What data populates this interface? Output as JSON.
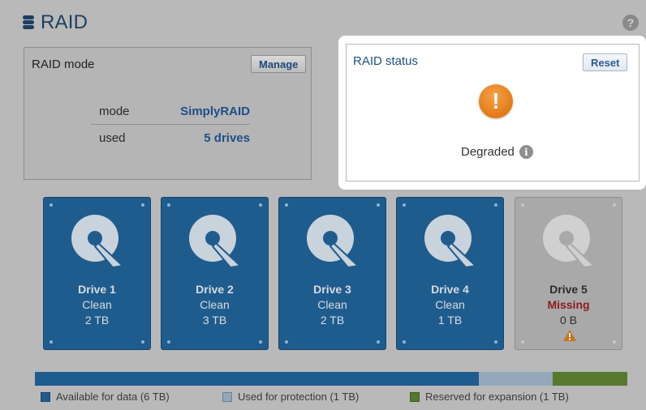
{
  "header": {
    "title": "RAID",
    "help_glyph": "?"
  },
  "mode_panel": {
    "label": "RAID mode",
    "manage_label": "Manage",
    "rows": [
      {
        "key": "mode",
        "value": "SimplyRAID"
      },
      {
        "key": "used",
        "value": "5 drives"
      }
    ]
  },
  "status_panel": {
    "label": "RAID status",
    "reset_label": "Reset",
    "alert_glyph": "!",
    "status_text": "Degraded",
    "info_glyph": "i"
  },
  "drives": [
    {
      "name": "Drive 1",
      "status": "Clean",
      "size": "2 TB"
    },
    {
      "name": "Drive 2",
      "status": "Clean",
      "size": "3 TB"
    },
    {
      "name": "Drive 3",
      "status": "Clean",
      "size": "2 TB"
    },
    {
      "name": "Drive 4",
      "status": "Clean",
      "size": "1 TB"
    },
    {
      "name": "Drive 5",
      "status": "Missing",
      "size": "0 B"
    }
  ],
  "capacity": {
    "segments": [
      {
        "label": "Available for data (6 TB)",
        "color": "#1f5c8e",
        "tb": 6
      },
      {
        "label": "Used for protection (1 TB)",
        "color": "#93a8bb",
        "tb": 1
      },
      {
        "label": "Reserved for expansion (1 TB)",
        "color": "#567a2c",
        "tb": 1
      }
    ]
  },
  "colors": {
    "accent": "#1d4f86",
    "drive_blue": "#1f5c8e",
    "alert_orange": "#e27a14",
    "missing_red": "#8e1b1b"
  },
  "icons": [
    "database-icon",
    "help-icon",
    "alert-icon",
    "info-icon",
    "drive-platter-icon",
    "warning-icon"
  ]
}
